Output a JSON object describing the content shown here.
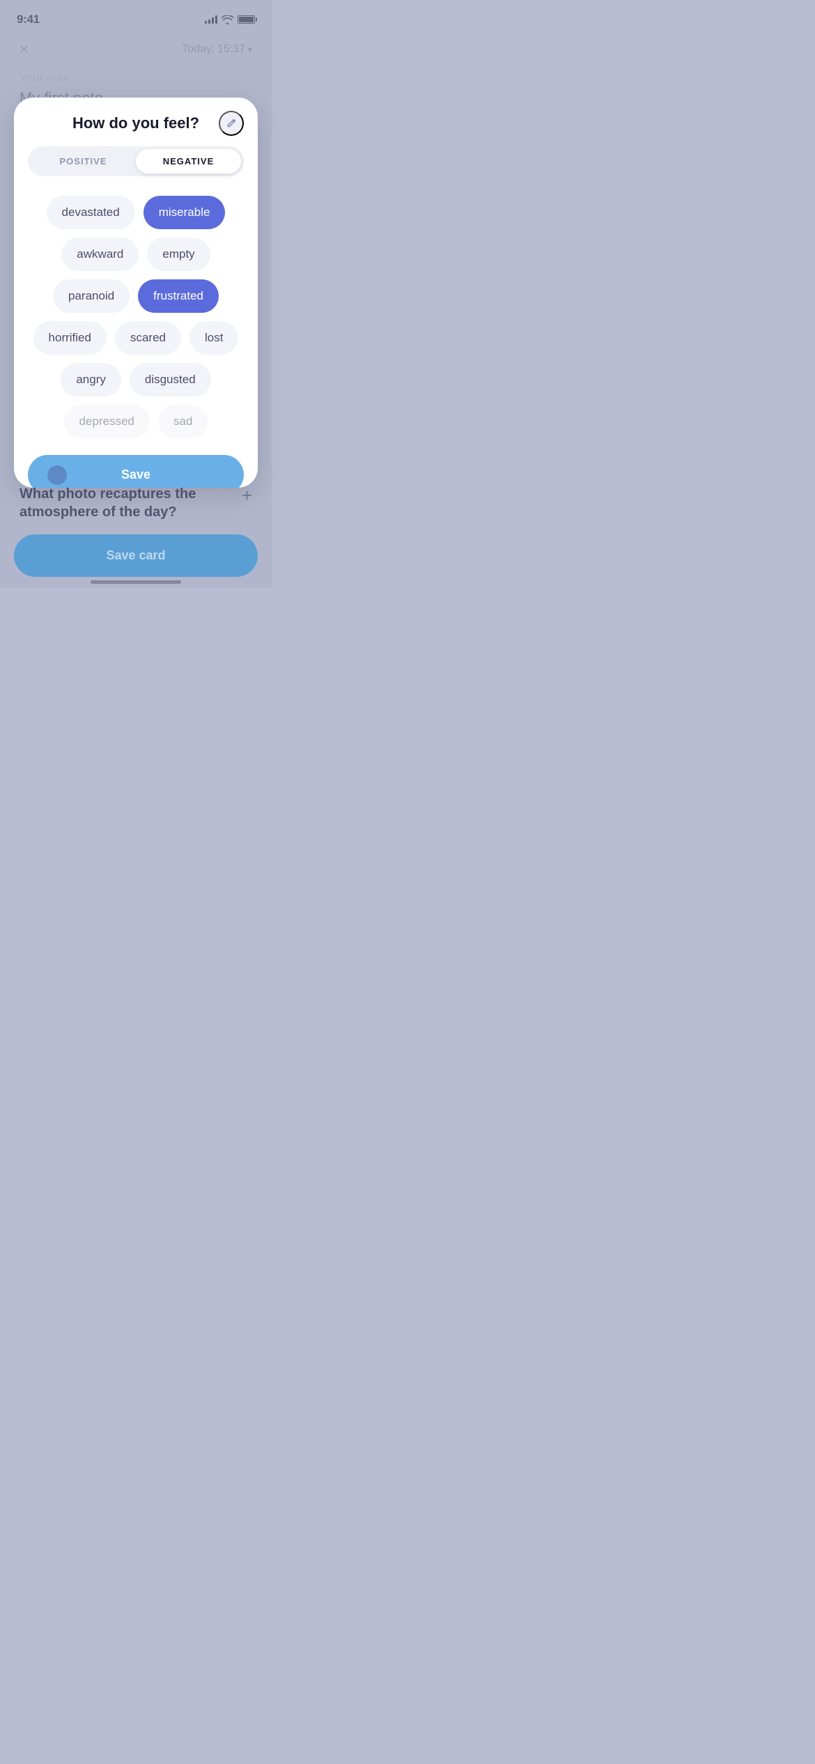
{
  "statusBar": {
    "time": "9:41",
    "batteryFull": true
  },
  "nav": {
    "closeLabel": "×",
    "dateLabel": "Today, 15:37",
    "chevron": "▾"
  },
  "note": {
    "label": "Your note",
    "text": "My first note"
  },
  "modal": {
    "title": "How do you feel?",
    "editIconLabel": "edit",
    "tabs": [
      {
        "id": "positive",
        "label": "POSITIVE",
        "active": false
      },
      {
        "id": "negative",
        "label": "NEGATIVE",
        "active": true
      }
    ],
    "emotions": [
      {
        "id": "devastated",
        "label": "devastated",
        "selected": false,
        "faded": false
      },
      {
        "id": "miserable",
        "label": "miserable",
        "selected": true,
        "faded": false
      },
      {
        "id": "awkward",
        "label": "awkward",
        "selected": false,
        "faded": false
      },
      {
        "id": "empty",
        "label": "empty",
        "selected": false,
        "faded": false
      },
      {
        "id": "paranoid",
        "label": "paranoid",
        "selected": false,
        "faded": false
      },
      {
        "id": "frustrated",
        "label": "frustrated",
        "selected": true,
        "faded": false
      },
      {
        "id": "horrified",
        "label": "horrified",
        "selected": false,
        "faded": false
      },
      {
        "id": "scared",
        "label": "scared",
        "selected": false,
        "faded": false
      },
      {
        "id": "lost",
        "label": "lost",
        "selected": false,
        "faded": false
      },
      {
        "id": "angry",
        "label": "angry",
        "selected": false,
        "faded": false
      },
      {
        "id": "disgusted",
        "label": "disgusted",
        "selected": false,
        "faded": false
      },
      {
        "id": "depressed",
        "label": "depressed",
        "selected": false,
        "faded": true
      },
      {
        "id": "sad",
        "label": "sad",
        "selected": false,
        "faded": true
      }
    ],
    "saveButtonLabel": "Save"
  },
  "bottomSection": {
    "question": "What photo recaptures the atmosphere of the day?",
    "addIcon": "+"
  },
  "saveCard": {
    "label": "Save card"
  }
}
